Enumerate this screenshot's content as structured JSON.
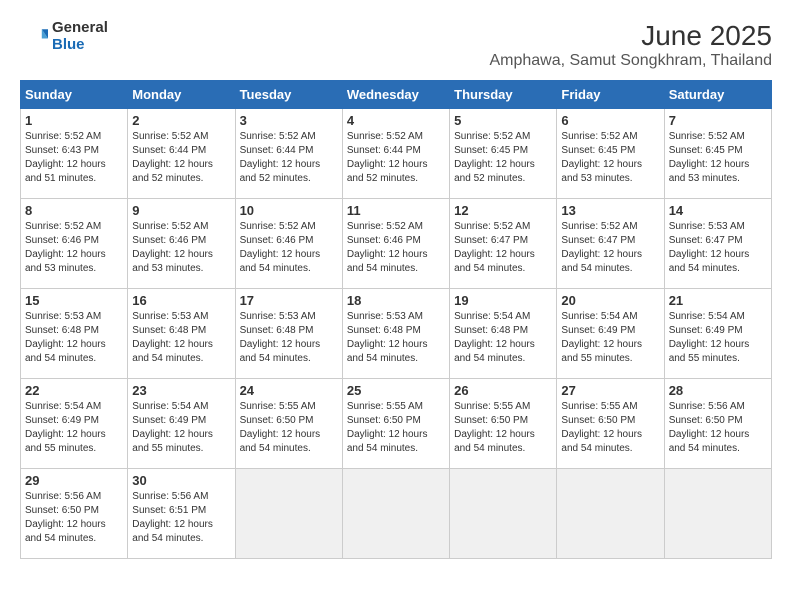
{
  "header": {
    "logo_line1": "General",
    "logo_line2": "Blue",
    "title": "June 2025",
    "subtitle": "Amphawa, Samut Songkhram, Thailand"
  },
  "calendar": {
    "weekdays": [
      "Sunday",
      "Monday",
      "Tuesday",
      "Wednesday",
      "Thursday",
      "Friday",
      "Saturday"
    ],
    "weeks": [
      [
        {
          "day": null
        },
        {
          "day": 2,
          "sunrise": "5:52 AM",
          "sunset": "6:44 PM",
          "daylight": "12 hours and 52 minutes."
        },
        {
          "day": 3,
          "sunrise": "5:52 AM",
          "sunset": "6:44 PM",
          "daylight": "12 hours and 52 minutes."
        },
        {
          "day": 4,
          "sunrise": "5:52 AM",
          "sunset": "6:44 PM",
          "daylight": "12 hours and 52 minutes."
        },
        {
          "day": 5,
          "sunrise": "5:52 AM",
          "sunset": "6:45 PM",
          "daylight": "12 hours and 52 minutes."
        },
        {
          "day": 6,
          "sunrise": "5:52 AM",
          "sunset": "6:45 PM",
          "daylight": "12 hours and 53 minutes."
        },
        {
          "day": 7,
          "sunrise": "5:52 AM",
          "sunset": "6:45 PM",
          "daylight": "12 hours and 53 minutes."
        }
      ],
      [
        {
          "day": 1,
          "sunrise": "5:52 AM",
          "sunset": "6:43 PM",
          "daylight": "12 hours and 51 minutes."
        },
        {
          "day": 9,
          "sunrise": "5:52 AM",
          "sunset": "6:46 PM",
          "daylight": "12 hours and 53 minutes."
        },
        {
          "day": 10,
          "sunrise": "5:52 AM",
          "sunset": "6:46 PM",
          "daylight": "12 hours and 54 minutes."
        },
        {
          "day": 11,
          "sunrise": "5:52 AM",
          "sunset": "6:46 PM",
          "daylight": "12 hours and 54 minutes."
        },
        {
          "day": 12,
          "sunrise": "5:52 AM",
          "sunset": "6:47 PM",
          "daylight": "12 hours and 54 minutes."
        },
        {
          "day": 13,
          "sunrise": "5:52 AM",
          "sunset": "6:47 PM",
          "daylight": "12 hours and 54 minutes."
        },
        {
          "day": 14,
          "sunrise": "5:53 AM",
          "sunset": "6:47 PM",
          "daylight": "12 hours and 54 minutes."
        }
      ],
      [
        {
          "day": 8,
          "sunrise": "5:52 AM",
          "sunset": "6:46 PM",
          "daylight": "12 hours and 53 minutes."
        },
        {
          "day": 16,
          "sunrise": "5:53 AM",
          "sunset": "6:48 PM",
          "daylight": "12 hours and 54 minutes."
        },
        {
          "day": 17,
          "sunrise": "5:53 AM",
          "sunset": "6:48 PM",
          "daylight": "12 hours and 54 minutes."
        },
        {
          "day": 18,
          "sunrise": "5:53 AM",
          "sunset": "6:48 PM",
          "daylight": "12 hours and 54 minutes."
        },
        {
          "day": 19,
          "sunrise": "5:54 AM",
          "sunset": "6:48 PM",
          "daylight": "12 hours and 54 minutes."
        },
        {
          "day": 20,
          "sunrise": "5:54 AM",
          "sunset": "6:49 PM",
          "daylight": "12 hours and 55 minutes."
        },
        {
          "day": 21,
          "sunrise": "5:54 AM",
          "sunset": "6:49 PM",
          "daylight": "12 hours and 55 minutes."
        }
      ],
      [
        {
          "day": 15,
          "sunrise": "5:53 AM",
          "sunset": "6:48 PM",
          "daylight": "12 hours and 54 minutes."
        },
        {
          "day": 23,
          "sunrise": "5:54 AM",
          "sunset": "6:49 PM",
          "daylight": "12 hours and 55 minutes."
        },
        {
          "day": 24,
          "sunrise": "5:55 AM",
          "sunset": "6:50 PM",
          "daylight": "12 hours and 54 minutes."
        },
        {
          "day": 25,
          "sunrise": "5:55 AM",
          "sunset": "6:50 PM",
          "daylight": "12 hours and 54 minutes."
        },
        {
          "day": 26,
          "sunrise": "5:55 AM",
          "sunset": "6:50 PM",
          "daylight": "12 hours and 54 minutes."
        },
        {
          "day": 27,
          "sunrise": "5:55 AM",
          "sunset": "6:50 PM",
          "daylight": "12 hours and 54 minutes."
        },
        {
          "day": 28,
          "sunrise": "5:56 AM",
          "sunset": "6:50 PM",
          "daylight": "12 hours and 54 minutes."
        }
      ],
      [
        {
          "day": 22,
          "sunrise": "5:54 AM",
          "sunset": "6:49 PM",
          "daylight": "12 hours and 55 minutes."
        },
        {
          "day": 30,
          "sunrise": "5:56 AM",
          "sunset": "6:51 PM",
          "daylight": "12 hours and 54 minutes."
        },
        {
          "day": null
        },
        {
          "day": null
        },
        {
          "day": null
        },
        {
          "day": null
        },
        {
          "day": null
        }
      ],
      [
        {
          "day": 29,
          "sunrise": "5:56 AM",
          "sunset": "6:50 PM",
          "daylight": "12 hours and 54 minutes."
        },
        {
          "day": null
        },
        {
          "day": null
        },
        {
          "day": null
        },
        {
          "day": null
        },
        {
          "day": null
        },
        {
          "day": null
        }
      ]
    ]
  }
}
